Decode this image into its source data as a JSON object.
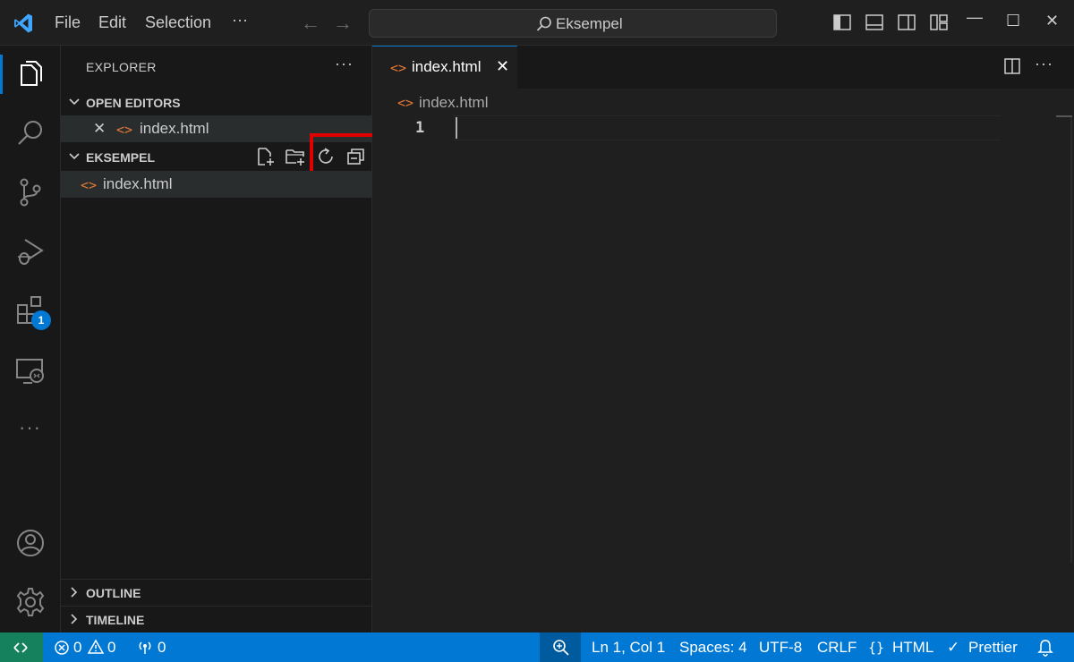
{
  "titlebar": {
    "menu": [
      "File",
      "Edit",
      "Selection",
      "···"
    ],
    "search_text": "Eksempel"
  },
  "activitybar": {
    "extensions_badge": "1",
    "more": "···"
  },
  "sidebar": {
    "title": "EXPLORER",
    "more": "···",
    "open_editors": {
      "label": "OPEN EDITORS",
      "files": [
        {
          "name": "index.html"
        }
      ]
    },
    "folder": {
      "label": "EKSEMPEL",
      "files": [
        {
          "name": "index.html"
        }
      ]
    },
    "outline_label": "OUTLINE",
    "timeline_label": "TIMELINE"
  },
  "editor": {
    "tab_label": "index.html",
    "breadcrumb": "index.html",
    "line_number": "1",
    "more": "···"
  },
  "statusbar": {
    "errors": "0",
    "warnings": "0",
    "ports": "0",
    "position": "Ln 1, Col 1",
    "spaces": "Spaces: 4",
    "encoding": "UTF-8",
    "eol": "CRLF",
    "language": "HTML",
    "formatter": "Prettier"
  },
  "colors": {
    "accent": "#0078d4",
    "remote": "#16825d",
    "highlight_box": "#e00000",
    "html_icon": "#e37933"
  }
}
